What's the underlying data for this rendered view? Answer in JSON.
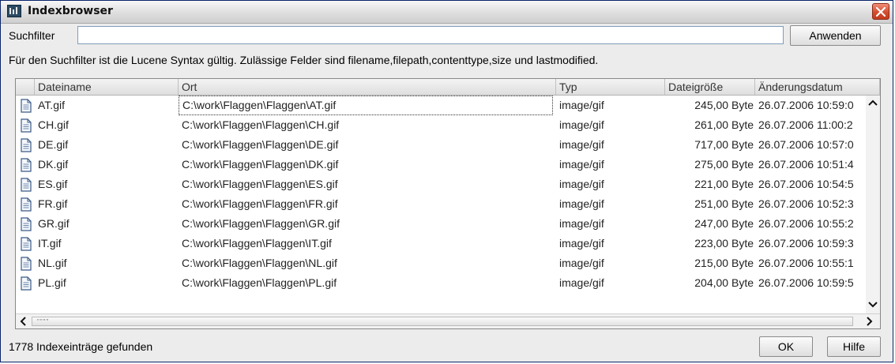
{
  "window": {
    "title": "Indexbrowser",
    "icon": "app-icon",
    "close_icon": "close-icon"
  },
  "filter": {
    "label": "Suchfilter",
    "value": "",
    "apply_label": "Anwenden",
    "hint": "Für den Suchfilter ist die Lucene Syntax gültig. Zulässige Felder sind filename,filepath,contenttype,size und lastmodified."
  },
  "table": {
    "columns": [
      "Dateiname",
      "Ort",
      "Typ",
      "Dateigröße",
      "Änderungsdatum"
    ],
    "rows": [
      {
        "name": "AT.gif",
        "path": "C:\\work\\Flaggen\\Flaggen\\AT.gif",
        "type": "image/gif",
        "size": "245,00 Byte",
        "date": "26.07.2006 10:59:0",
        "selected": true
      },
      {
        "name": "CH.gif",
        "path": "C:\\work\\Flaggen\\Flaggen\\CH.gif",
        "type": "image/gif",
        "size": "261,00 Byte",
        "date": "26.07.2006 11:00:2"
      },
      {
        "name": "DE.gif",
        "path": "C:\\work\\Flaggen\\Flaggen\\DE.gif",
        "type": "image/gif",
        "size": "717,00 Byte",
        "date": "26.07.2006 10:57:0"
      },
      {
        "name": "DK.gif",
        "path": "C:\\work\\Flaggen\\Flaggen\\DK.gif",
        "type": "image/gif",
        "size": "275,00 Byte",
        "date": "26.07.2006 10:51:4"
      },
      {
        "name": "ES.gif",
        "path": "C:\\work\\Flaggen\\Flaggen\\ES.gif",
        "type": "image/gif",
        "size": "221,00 Byte",
        "date": "26.07.2006 10:54:5"
      },
      {
        "name": "FR.gif",
        "path": "C:\\work\\Flaggen\\Flaggen\\FR.gif",
        "type": "image/gif",
        "size": "251,00 Byte",
        "date": "26.07.2006 10:52:3"
      },
      {
        "name": "GR.gif",
        "path": "C:\\work\\Flaggen\\Flaggen\\GR.gif",
        "type": "image/gif",
        "size": "247,00 Byte",
        "date": "26.07.2006 10:55:2"
      },
      {
        "name": "IT.gif",
        "path": "C:\\work\\Flaggen\\Flaggen\\IT.gif",
        "type": "image/gif",
        "size": "223,00 Byte",
        "date": "26.07.2006 10:59:3"
      },
      {
        "name": "NL.gif",
        "path": "C:\\work\\Flaggen\\Flaggen\\NL.gif",
        "type": "image/gif",
        "size": "215,00 Byte",
        "date": "26.07.2006 10:55:1"
      },
      {
        "name": "PL.gif",
        "path": "C:\\work\\Flaggen\\Flaggen\\PL.gif",
        "type": "image/gif",
        "size": "204,00 Byte",
        "date": "26.07.2006 10:59:5"
      }
    ],
    "row_icon": "document-icon"
  },
  "status": {
    "text": "1778 Indexeinträge gefunden"
  },
  "buttons": {
    "ok": "OK",
    "help": "Hilfe"
  },
  "colors": {
    "close_button": "#d44d2e",
    "input_border": "#7f9db9"
  }
}
